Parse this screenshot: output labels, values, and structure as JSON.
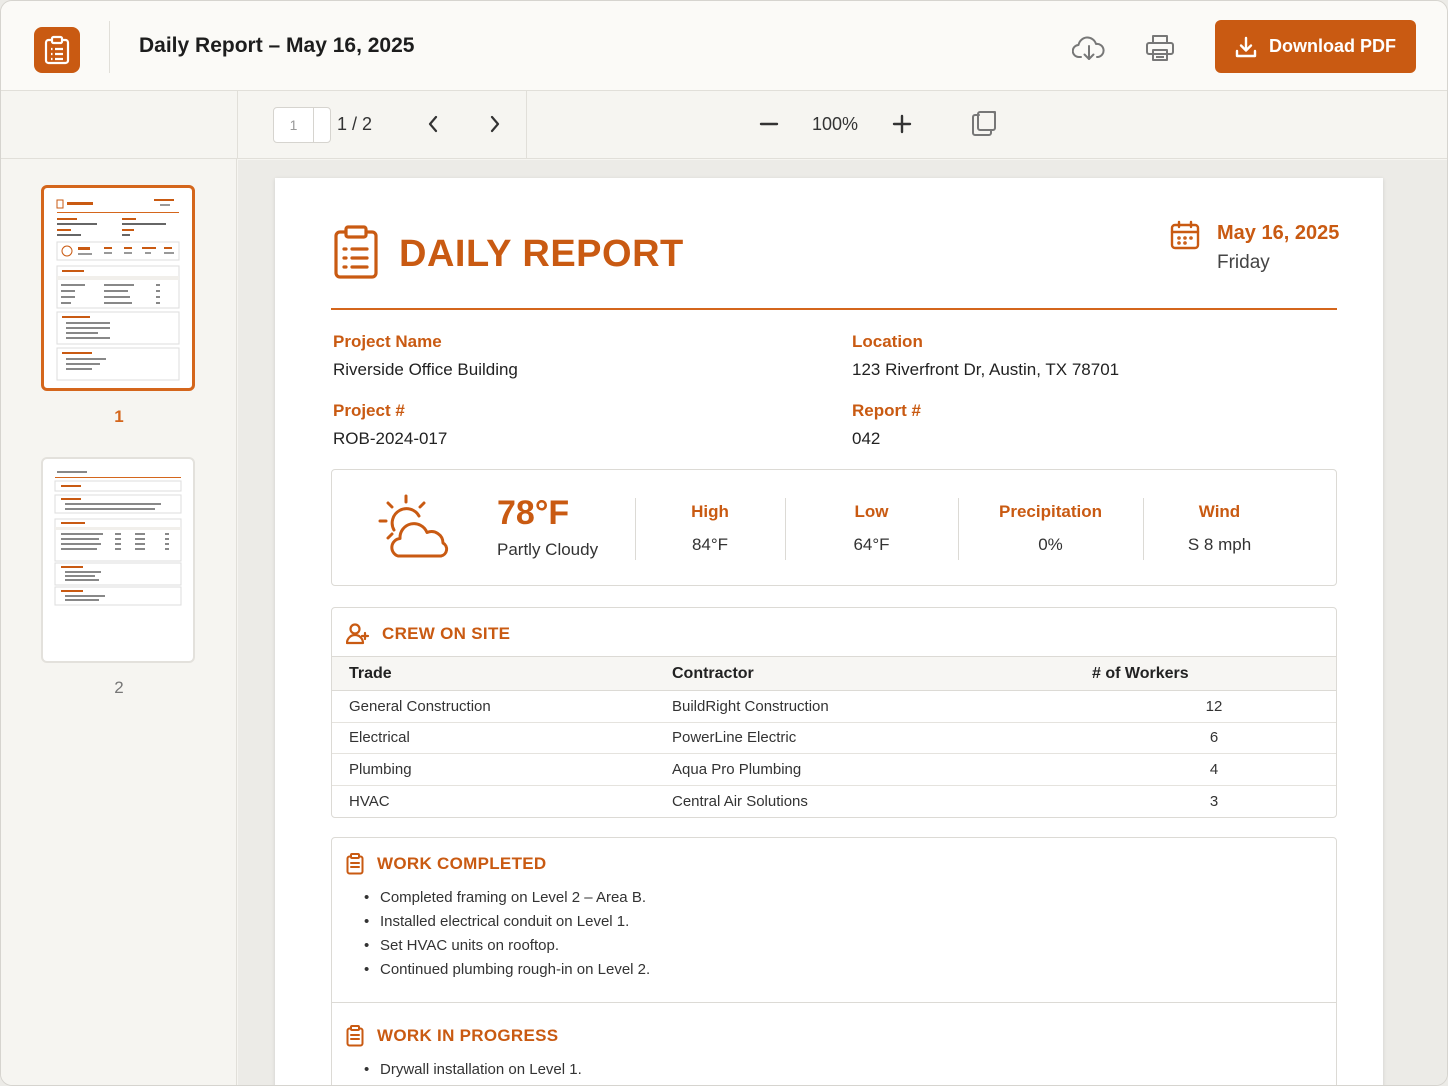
{
  "header": {
    "doc_title": "Daily Report – May 16, 2025",
    "download_label": "Download PDF"
  },
  "toolbar": {
    "page_input_value": "1",
    "page_count": "1 / 2",
    "zoom": "100%"
  },
  "sidebar": {
    "thumbnails": [
      {
        "label": "1",
        "active": true
      },
      {
        "label": "2",
        "active": false
      }
    ]
  },
  "report": {
    "title": "DAILY REPORT",
    "date": "May 16, 2025",
    "day": "Friday",
    "project_name_label": "Project Name",
    "project_name": "Riverside Office Building",
    "location_label": "Location",
    "location": "123 Riverfront Dr, Austin, TX 78701",
    "project_no_label": "Project #",
    "project_no": "ROB-2024-017",
    "report_no_label": "Report #",
    "report_no": "042"
  },
  "weather": {
    "temp": "78°F",
    "condition": "Partly Cloudy",
    "high_label": "High",
    "high": "84°F",
    "low_label": "Low",
    "low": "64°F",
    "precip_label": "Precipitation",
    "precip": "0%",
    "wind_label": "Wind",
    "wind": "S 8 mph"
  },
  "crew": {
    "title": "CREW ON SITE",
    "headers": [
      "Trade",
      "Contractor",
      "# of Workers"
    ],
    "rows": [
      [
        "General Construction",
        "BuildRight Construction",
        "12"
      ],
      [
        "Electrical",
        "PowerLine Electric",
        "6"
      ],
      [
        "Plumbing",
        "Aqua Pro Plumbing",
        "4"
      ],
      [
        "HVAC",
        "Central Air Solutions",
        "3"
      ]
    ]
  },
  "work_completed": {
    "title": "WORK COMPLETED",
    "items": [
      "Completed framing on Level 2 – Area B.",
      "Installed electrical conduit on Level 1.",
      "Set HVAC units on rooftop.",
      "Continued plumbing rough-in on Level 2."
    ]
  },
  "work_in_progress": {
    "title": "WORK IN PROGRESS",
    "items": [
      "Drywall installation on Level 1."
    ]
  },
  "colors": {
    "accent": "#c95a12",
    "accent_light": "#d4661c"
  }
}
